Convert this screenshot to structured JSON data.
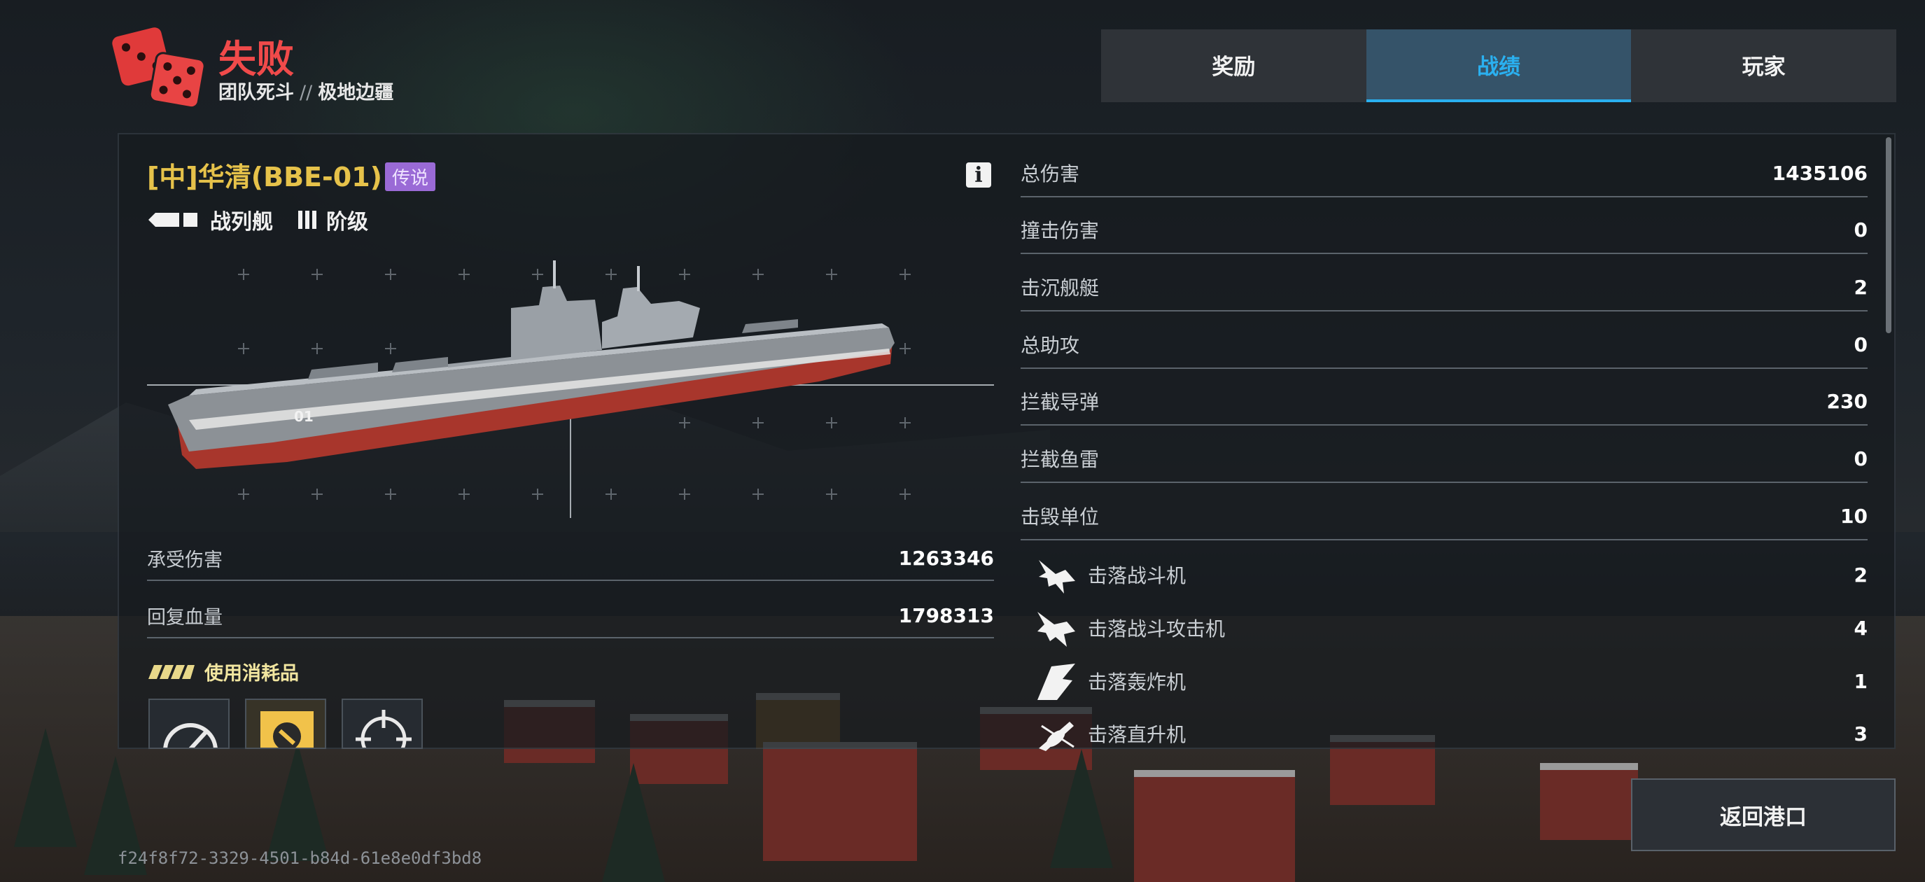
{
  "header": {
    "result": "失败",
    "mode": "团队死斗",
    "separator": "//",
    "map": "极地边疆",
    "icon": "dice-icon"
  },
  "tabs": [
    {
      "label": "奖励",
      "active": false
    },
    {
      "label": "战绩",
      "active": true
    },
    {
      "label": "玩家",
      "active": false
    }
  ],
  "ship": {
    "name": "[中]华清(BBE-01)",
    "rarity": "传说",
    "type": "战列舰",
    "tier": "阶级",
    "hull_number": "01"
  },
  "left_stats": [
    {
      "label": "承受伤害",
      "value": "1263346"
    },
    {
      "label": "回复血量",
      "value": "1798313"
    }
  ],
  "consumables": {
    "label": "使用消耗品",
    "items": [
      "speed-gauge-icon",
      "repair-icon",
      "crosshair-icon"
    ]
  },
  "stats": [
    {
      "label": "总伤害",
      "value": "1435106"
    },
    {
      "label": "撞击伤害",
      "value": "0"
    },
    {
      "label": "击沉舰艇",
      "value": "2"
    },
    {
      "label": "总助攻",
      "value": "0"
    },
    {
      "label": "拦截导弹",
      "value": "230"
    },
    {
      "label": "拦截鱼雷",
      "value": "0"
    },
    {
      "label": "击毁单位",
      "value": "10"
    }
  ],
  "sub_stats": [
    {
      "label": "击落战斗机",
      "value": "2",
      "icon": "fighter-jet-icon"
    },
    {
      "label": "击落战斗攻击机",
      "value": "4",
      "icon": "attack-jet-icon"
    },
    {
      "label": "击落轰炸机",
      "value": "1",
      "icon": "bomber-icon"
    },
    {
      "label": "击落直升机",
      "value": "3",
      "icon": "helicopter-icon"
    }
  ],
  "return_button": "返回港口",
  "match_id": "f24f8f72-3329-4501-b84d-61e8e0df3bd8",
  "colors": {
    "defeat": "#f04a4a",
    "active_tab": "#2ab0f0",
    "ship_name": "#e6c24a",
    "rarity": "#9a6ad6"
  }
}
